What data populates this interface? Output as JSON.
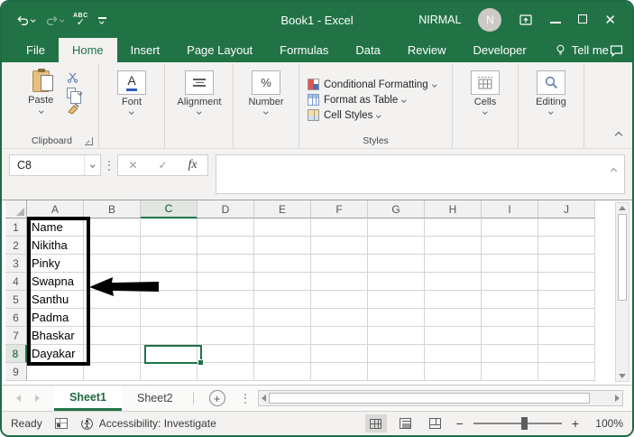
{
  "window": {
    "title": "Book1 - Excel",
    "user": "NIRMAL",
    "avatar_initial": "N"
  },
  "qat": {
    "spelling": "ABC"
  },
  "tabs": {
    "items": [
      "File",
      "Home",
      "Insert",
      "Page Layout",
      "Formulas",
      "Data",
      "Review",
      "Developer"
    ],
    "active": "Home",
    "tell_me": "Tell me"
  },
  "ribbon": {
    "clipboard": {
      "paste": "Paste",
      "group": "Clipboard"
    },
    "font": {
      "icon_letter": "A",
      "group": "Font"
    },
    "alignment": {
      "group": "Alignment"
    },
    "number": {
      "icon": "%",
      "group": "Number"
    },
    "styles": {
      "items": [
        "Conditional Formatting",
        "Format as Table",
        "Cell Styles"
      ],
      "group": "Styles"
    },
    "cells": {
      "group": "Cells"
    },
    "editing": {
      "group": "Editing"
    }
  },
  "formula": {
    "name_box": "C8",
    "fx_label": "fx",
    "value": ""
  },
  "grid": {
    "columns": [
      "A",
      "B",
      "C",
      "D",
      "E",
      "F",
      "G",
      "H",
      "I",
      "J"
    ],
    "selected_cell": "C8",
    "selected_column": "C",
    "selected_row": "8",
    "rows": [
      {
        "n": "1",
        "a": "Name"
      },
      {
        "n": "2",
        "a": "Nikitha"
      },
      {
        "n": "3",
        "a": "Pinky"
      },
      {
        "n": "4",
        "a": "Swapna"
      },
      {
        "n": "5",
        "a": "Santhu"
      },
      {
        "n": "6",
        "a": "Padma"
      },
      {
        "n": "7",
        "a": "Bhaskar"
      },
      {
        "n": "8",
        "a": "Dayakar"
      },
      {
        "n": "9",
        "a": ""
      }
    ]
  },
  "sheets": {
    "items": [
      "Sheet1",
      "Sheet2"
    ],
    "active": "Sheet1"
  },
  "status": {
    "ready": "Ready",
    "accessibility": "Accessibility: Investigate",
    "zoom_level": "100%"
  },
  "icons": {
    "close": "✕",
    "check": "✓",
    "cancel": "✕",
    "plus": "+",
    "zoom_out": "−",
    "zoom_in": "+"
  },
  "colors": {
    "excel_green": "#217346",
    "grid_line": "#d4d4d4",
    "annotation": "#000000"
  }
}
